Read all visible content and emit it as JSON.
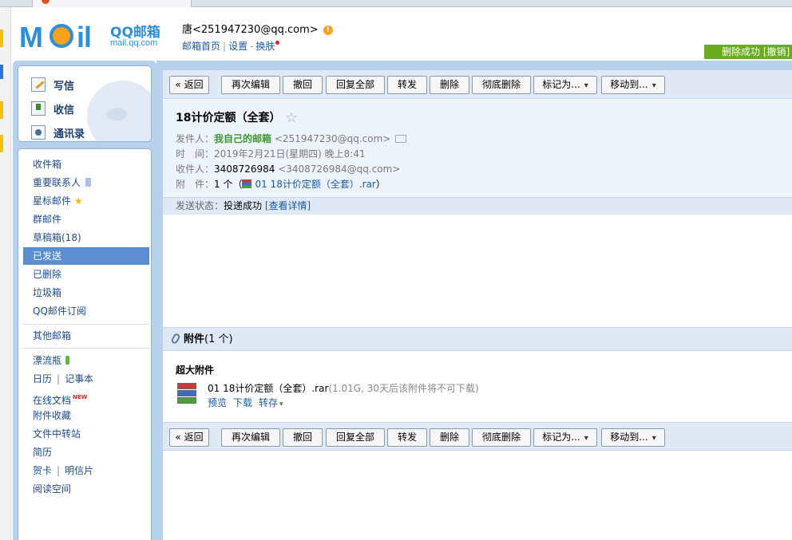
{
  "colors": {
    "brand_blue": "#2d8fdc",
    "toast_green": "#6aac1f",
    "selected_folder": "#5a8ed1",
    "sidebar_bg": "#b7d0ec"
  },
  "logo": {
    "text_m": "M",
    "text_il": "il",
    "name": "QQ邮箱",
    "domain": "mail.qq.com"
  },
  "header": {
    "user": "唐<251947230@qq.com>",
    "warn_glyph": "!",
    "links": [
      "邮箱首页",
      "设置",
      "换肤"
    ],
    "toast": "删除成功 [撤销]"
  },
  "quick_actions": [
    {
      "label": "写信",
      "icon": "pencil-icon"
    },
    {
      "label": "收信",
      "icon": "inbox-arrow-icon"
    },
    {
      "label": "通讯录",
      "icon": "contacts-icon"
    }
  ],
  "folders": {
    "inbox": "收件箱",
    "important": "重要联系人",
    "starred": "星标邮件",
    "group": "群邮件",
    "drafts": "草稿箱(18)",
    "sent": "已发送",
    "deleted": "已删除",
    "spam": "垃圾箱",
    "subscription": "QQ邮件订阅",
    "other": "其他邮箱",
    "bottle": "漂流瓶",
    "calendar": "日历",
    "notes": "记事本",
    "docs": "在线文档",
    "docs_badge": "NEW",
    "attach_fav": "附件收藏",
    "file_transfer": "文件中转站",
    "resume": "简历",
    "greeting_card": "贺卡",
    "postcard": "明信片",
    "reading": "阅读空间",
    "separator": "|",
    "star_glyph": "★"
  },
  "toolbar": {
    "back": "« 返回",
    "reedit": "再次编辑",
    "recall": "撤回",
    "reply_all": "回复全部",
    "forward": "转发",
    "delete": "删除",
    "perm_delete": "彻底删除",
    "mark_as": "标记为...",
    "move_to": "移动到..."
  },
  "mail": {
    "subject": "18计价定额（全套）",
    "star_glyph": "☆",
    "from_label": "发件人：",
    "from_name": "我自己的邮箱",
    "from_addr": "<251947230@qq.com>",
    "time_label": "时　间：",
    "time_value": "2019年2月21日(星期四) 晚上8:41",
    "to_label": "收件人：",
    "to_name": "3408726984",
    "to_addr": "<3408726984@qq.com>",
    "attach_label": "附　件：",
    "attach_count": "1 个（",
    "attach_name": "01 18计价定额（全套）.rar",
    "attach_close": "）",
    "status_label": "发送状态：",
    "status_value": "投递成功",
    "status_link": "[查看详情]"
  },
  "attachments": {
    "title": "附件",
    "count": "(1 个)",
    "super_title": "超大附件",
    "file_name": "01 18计价定额（全套）.rar",
    "file_meta": "(1.01G, 30天后该附件将不可下载)",
    "actions": {
      "preview": "预览",
      "download": "下载",
      "save": "转存"
    }
  }
}
